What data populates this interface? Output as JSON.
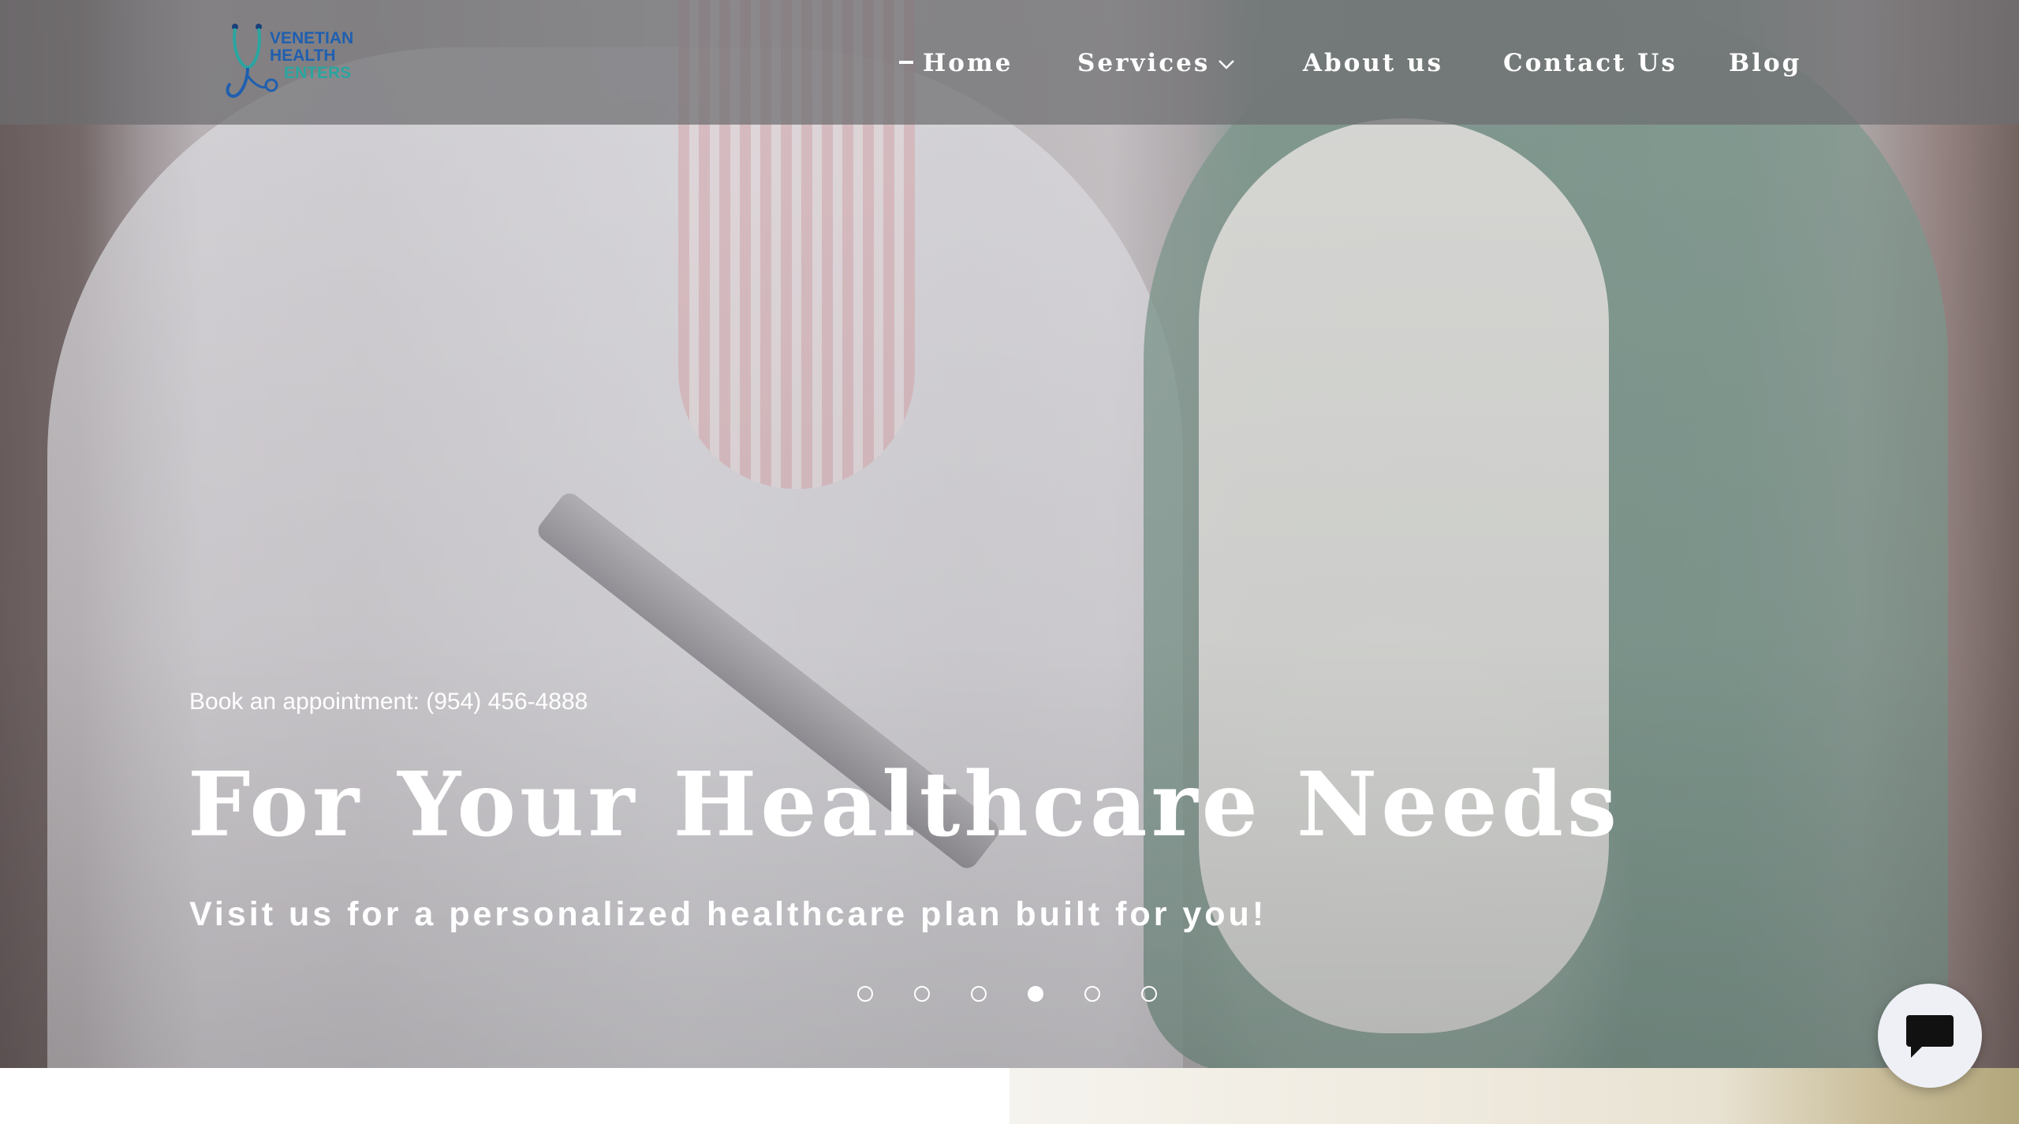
{
  "header": {
    "logo": {
      "line1": "VENETIAN",
      "line2": "HEALTH",
      "line3": "ENTERS"
    },
    "nav": [
      {
        "label": "Home",
        "active": true
      },
      {
        "label": "Services",
        "has_dropdown": true
      },
      {
        "label": "About us"
      },
      {
        "label": "Contact Us"
      },
      {
        "label": "Blog"
      }
    ]
  },
  "hero": {
    "appointment": "Book an appointment: (954) 456-4888",
    "headline": "For Your Healthcare Needs",
    "subheadline": "Visit us for a personalized healthcare plan built for you!",
    "slides_total": 6,
    "active_slide": 4
  },
  "chat": {
    "icon": "chat-bubble-icon"
  },
  "colors": {
    "logo_blue": "#1f5fb0",
    "logo_teal": "#2aa5a0",
    "header_overlay": "#6e6e70"
  }
}
